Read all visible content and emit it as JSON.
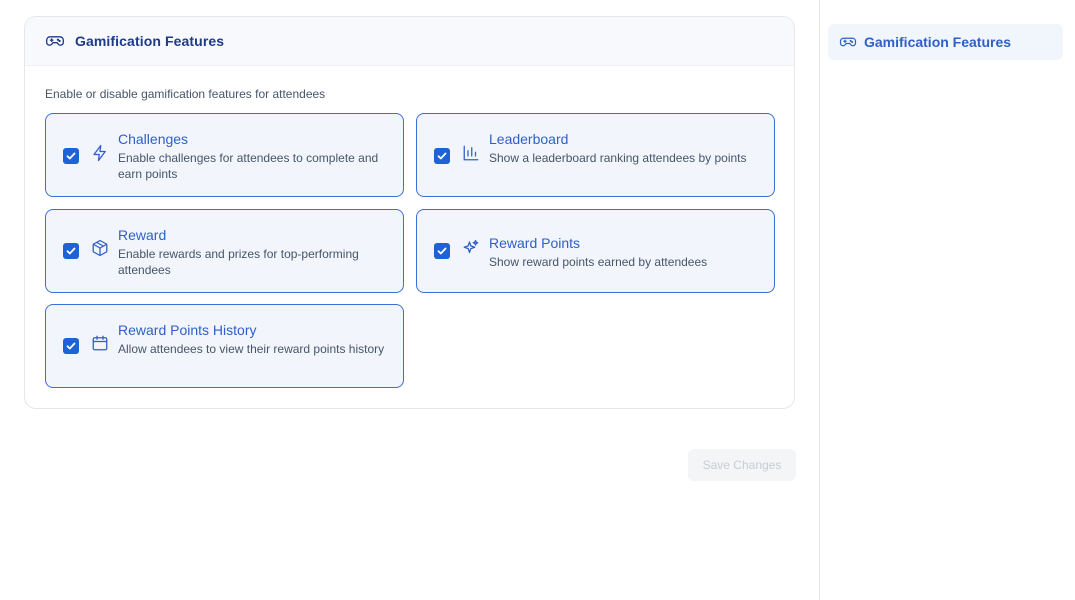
{
  "section": {
    "title": "Gamification Features",
    "title_icon": "gamepad-icon",
    "description": "Enable or disable gamification features for attendees"
  },
  "features": [
    {
      "name": "Challenges",
      "description": "Enable challenges for attendees to complete and earn points",
      "icon": "lightning-icon",
      "enabled": true
    },
    {
      "name": "Leaderboard",
      "description": "Show a leaderboard ranking attendees by points",
      "icon": "bar-chart-icon",
      "enabled": true
    },
    {
      "name": "Reward",
      "description": "Enable rewards and prizes for top-performing attendees",
      "icon": "package-icon",
      "enabled": true
    },
    {
      "name": "Reward Points",
      "description": "Show reward points earned by attendees",
      "icon": "sparkles-icon",
      "enabled": true
    },
    {
      "name": "Reward Points History",
      "description": "Allow attendees to view their reward points history",
      "icon": "calendar-icon",
      "enabled": true
    }
  ],
  "actions": {
    "save_label": "Save Changes",
    "save_disabled": true
  },
  "sidebar": {
    "items": [
      {
        "label": "Gamification Features",
        "icon": "gamepad-icon",
        "active": true
      }
    ]
  },
  "colors": {
    "accent": "#2f5fc7",
    "heading": "#1e3a8a",
    "checkbox": "#1d63d8",
    "card_border": "#3b6fd6",
    "card_bg": "#f2f5fb"
  }
}
